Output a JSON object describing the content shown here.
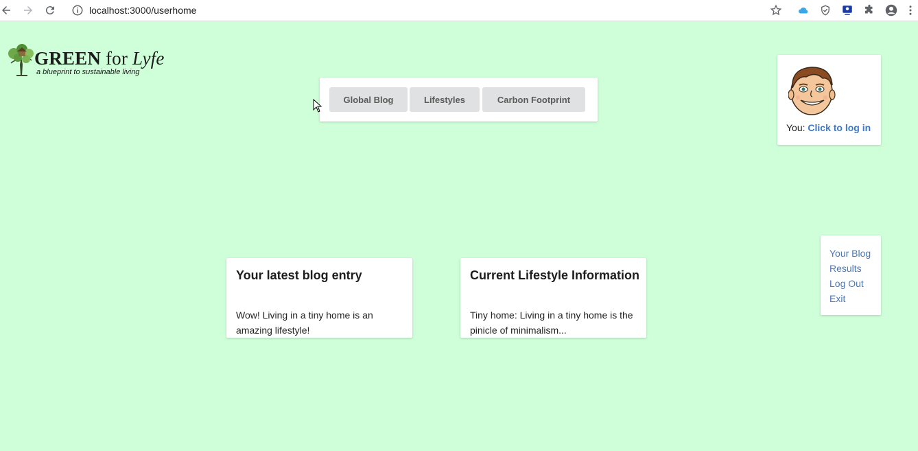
{
  "browser": {
    "url": "localhost:3000/userhome"
  },
  "logo": {
    "brand_bold": "GREEN",
    "brand_for": "for",
    "brand_italic": "Lyfe",
    "tagline": "a blueprint to sustainable living"
  },
  "nav": {
    "tabs": [
      {
        "label": "Global Blog"
      },
      {
        "label": "Lifestyles"
      },
      {
        "label": "Carbon Footprint"
      }
    ]
  },
  "profile": {
    "you_label": "You:",
    "login_link": "Click to log in"
  },
  "side_menu": {
    "items": [
      {
        "label": "Your Blog"
      },
      {
        "label": "Results"
      },
      {
        "label": "Log Out"
      },
      {
        "label": "Exit"
      }
    ]
  },
  "cards": [
    {
      "title": "Your latest blog entry",
      "body": "Wow! Living in a tiny home is an amazing lifestyle!"
    },
    {
      "title": "Current Lifestyle Information",
      "body": "Tiny home: Living in a tiny home is the pinicle of minimalism..."
    }
  ],
  "colors": {
    "page_background": "#ceffd8",
    "link": "#4a78b8",
    "tab_background": "#e0e1e2"
  }
}
